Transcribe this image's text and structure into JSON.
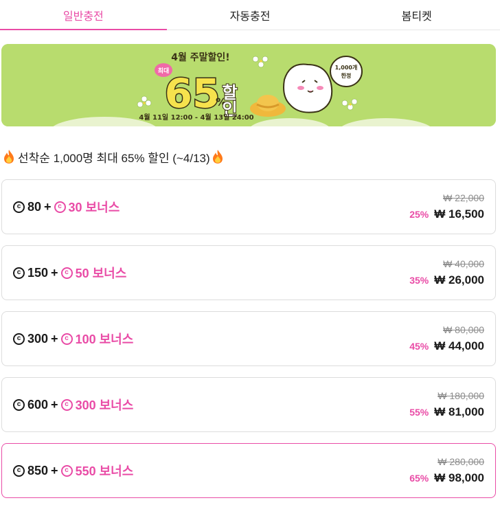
{
  "tabs": [
    {
      "label": "일반충전",
      "active": true
    },
    {
      "label": "자동충전",
      "active": false
    },
    {
      "label": "봄티켓",
      "active": false
    }
  ],
  "banner": {
    "headline": "4월 주말할인!",
    "badge": "최대",
    "percent": "65",
    "percent_sign": "%",
    "word": "할인",
    "period": "4월 11일 12:00 - 4월 13일 24:00",
    "bubble_line1": "1,000개",
    "bubble_line2": "한정"
  },
  "promo": {
    "icon": "fire-icon",
    "text": "선착순 1,000명 최대 65% 할인 (~4/13)"
  },
  "accent_color": "#e94ba6",
  "coin_symbol": "c",
  "plus": "+",
  "products": [
    {
      "coins": "80",
      "bonus": "30 보너스",
      "original": "₩ 22,000",
      "discount": "25%",
      "price": "₩ 16,500",
      "highlight": false
    },
    {
      "coins": "150",
      "bonus": "50 보너스",
      "original": "₩ 40,000",
      "discount": "35%",
      "price": "₩ 26,000",
      "highlight": false
    },
    {
      "coins": "300",
      "bonus": "100 보너스",
      "original": "₩ 80,000",
      "discount": "45%",
      "price": "₩ 44,000",
      "highlight": false
    },
    {
      "coins": "600",
      "bonus": "300 보너스",
      "original": "₩ 180,000",
      "discount": "55%",
      "price": "₩ 81,000",
      "highlight": false
    },
    {
      "coins": "850",
      "bonus": "550 보너스",
      "original": "₩ 280,000",
      "discount": "65%",
      "price": "₩ 98,000",
      "highlight": true
    }
  ]
}
